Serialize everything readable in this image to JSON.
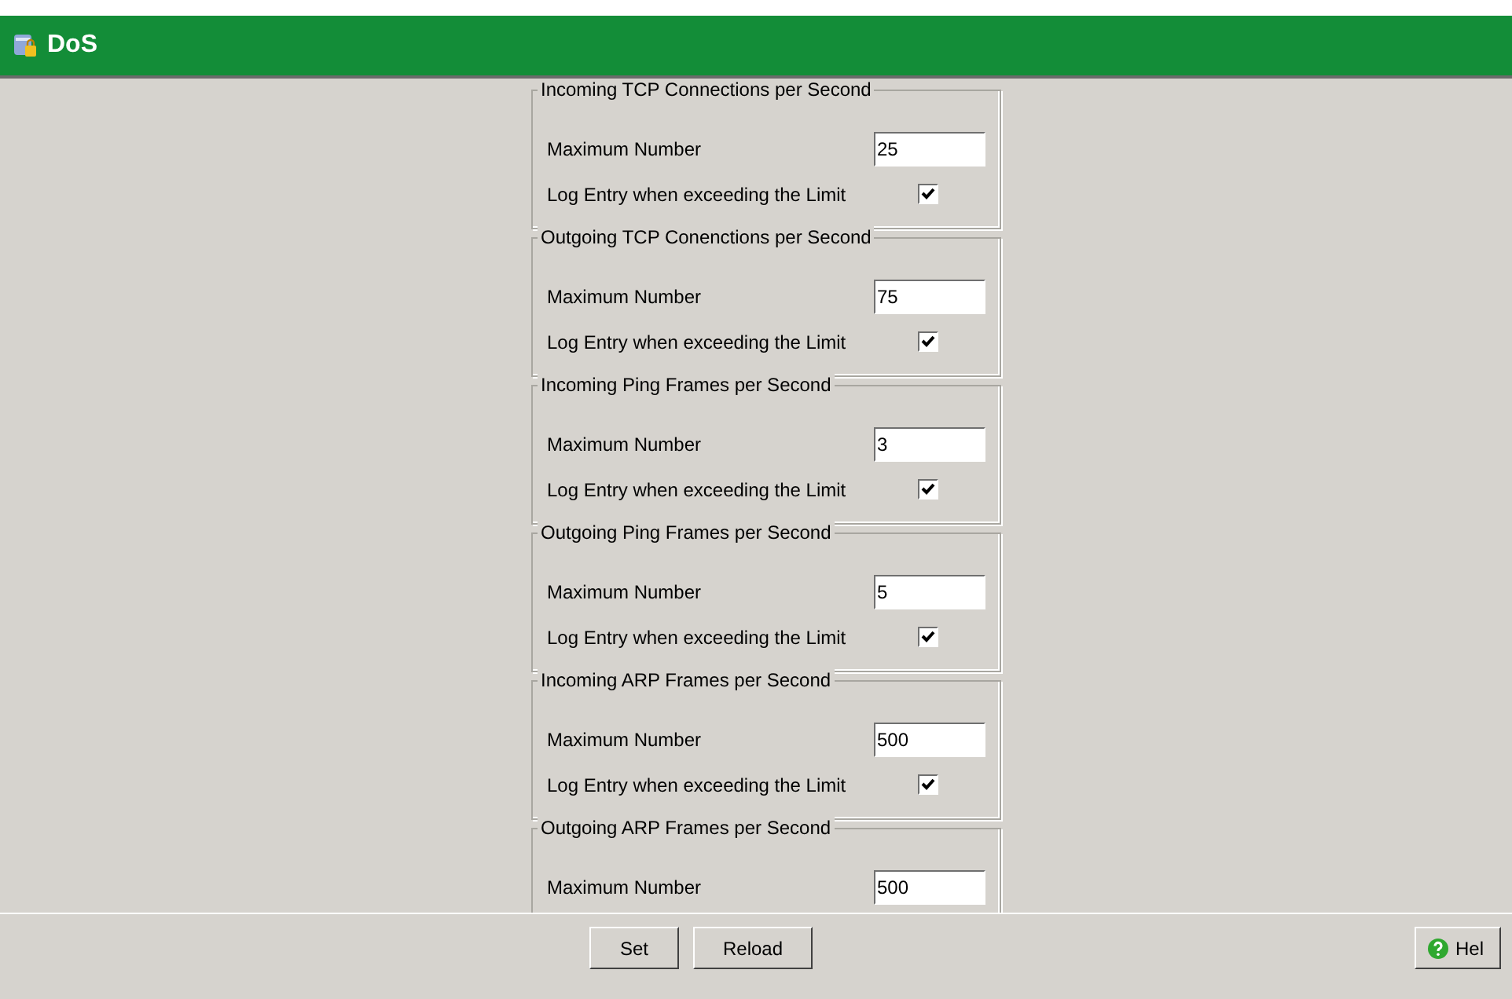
{
  "header": {
    "title": "DoS"
  },
  "groups": [
    {
      "title": "Incoming TCP Connections per Second",
      "max_label": "Maximum Number",
      "max_value": "25",
      "log_label": "Log Entry when exceeding the Limit",
      "log_checked": true
    },
    {
      "title": "Outgoing TCP Conenctions per Second",
      "max_label": "Maximum Number",
      "max_value": "75",
      "log_label": "Log Entry when exceeding the Limit",
      "log_checked": true
    },
    {
      "title": "Incoming Ping Frames per Second",
      "max_label": "Maximum Number",
      "max_value": "3",
      "log_label": "Log Entry when exceeding the Limit",
      "log_checked": true
    },
    {
      "title": "Outgoing Ping Frames per Second",
      "max_label": "Maximum Number",
      "max_value": "5",
      "log_label": "Log Entry when exceeding the Limit",
      "log_checked": true
    },
    {
      "title": "Incoming ARP Frames per Second",
      "max_label": "Maximum Number",
      "max_value": "500",
      "log_label": "Log Entry when exceeding the Limit",
      "log_checked": true
    },
    {
      "title": "Outgoing ARP Frames per Second",
      "max_label": "Maximum Number",
      "max_value": "500"
    }
  ],
  "buttons": [
    {
      "label": "Set",
      "kind": "plain"
    },
    {
      "label": "Reload",
      "kind": "plain"
    }
  ],
  "help_button": {
    "label": "Hel"
  }
}
